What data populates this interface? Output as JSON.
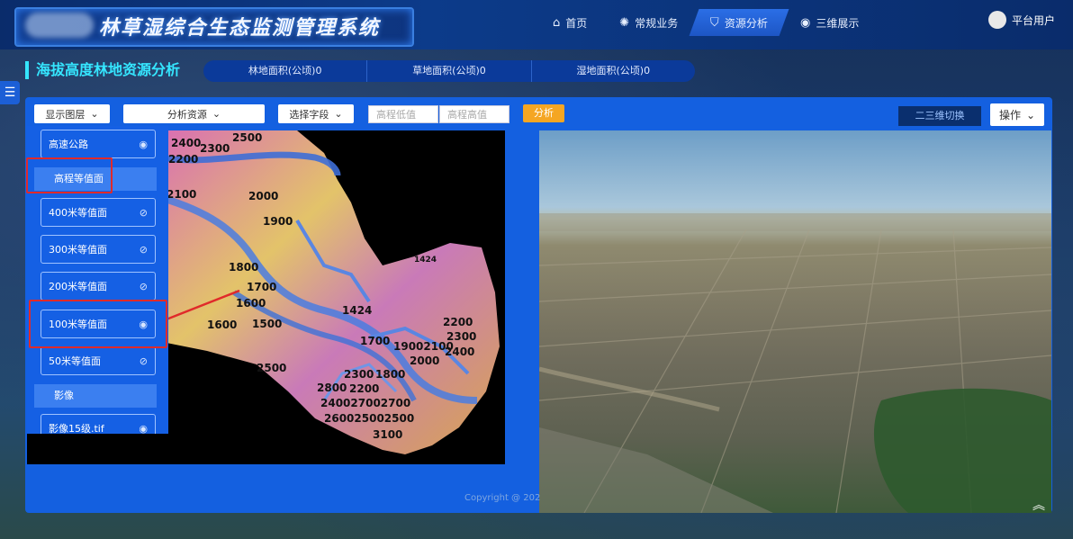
{
  "header": {
    "app_title": "林草湿综合生态监测管理系统",
    "nav": [
      {
        "icon": "home-icon",
        "label": "首页"
      },
      {
        "icon": "bulb-icon",
        "label": "常规业务"
      },
      {
        "icon": "shield-icon",
        "label": "资源分析"
      },
      {
        "icon": "globe-icon",
        "label": "三维展示"
      }
    ],
    "user": "平台用户"
  },
  "section": {
    "title": "海拔高度林地资源分析",
    "stats": [
      "林地面积(公顷)0",
      "草地面积(公顷)0",
      "湿地面积(公顷)0"
    ]
  },
  "toolbar": {
    "layer_select": "显示图层",
    "resource_select": "分析资源",
    "field_select": "选择字段",
    "min_placeholder": "高程低值",
    "max_placeholder": "高程高值",
    "analyze": "分析",
    "switch_view": "二三维切换",
    "ops": "操作"
  },
  "layers": {
    "items": [
      {
        "label": "高速公路",
        "visible": true
      },
      {
        "group": "高程等值面"
      },
      {
        "label": "400米等值面",
        "visible": false
      },
      {
        "label": "300米等值面",
        "visible": false
      },
      {
        "label": "200米等值面",
        "visible": false
      },
      {
        "label": "100米等值面",
        "visible": true
      },
      {
        "label": "50米等值面",
        "visible": false
      },
      {
        "group": "影像"
      },
      {
        "label": "影像15级.tif",
        "visible": true
      }
    ]
  },
  "map2d": {
    "contour_labels": [
      "2400",
      "2300",
      "2500",
      "2200",
      "2100",
      "2000",
      "1900",
      "1800",
      "1700",
      "1600",
      "1500",
      "1424",
      "1424",
      "1700",
      "19002100",
      "2000",
      "2200",
      "2300",
      "2400",
      "2500",
      "2300",
      "1800",
      "2800",
      "2200",
      "240027002700",
      "260025002500",
      "3100",
      "1600"
    ]
  },
  "footer": {
    "copyright": "Copyright @ 202"
  }
}
